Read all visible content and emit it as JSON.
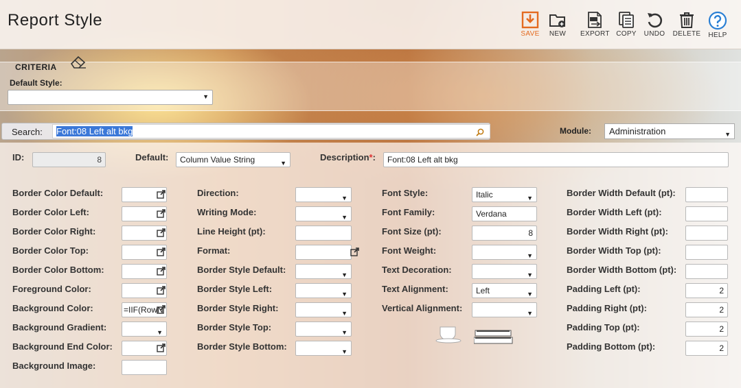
{
  "header": {
    "title": "Report Style",
    "toolbar": [
      {
        "id": "save",
        "label": "SAVE",
        "icon": "save-icon"
      },
      {
        "id": "new",
        "label": "NEW",
        "icon": "new-folder-icon"
      },
      {
        "id": "export",
        "label": "EXPORT",
        "icon": "export-txt-icon"
      },
      {
        "id": "copy",
        "label": "COPY",
        "icon": "copy-icon"
      },
      {
        "id": "undo",
        "label": "UNDO",
        "icon": "undo-icon"
      },
      {
        "id": "delete",
        "label": "DELETE",
        "icon": "trash-icon"
      },
      {
        "id": "help",
        "label": "HELP",
        "icon": "help-icon"
      }
    ]
  },
  "criteria": {
    "title": "CRITERIA",
    "default_style_label": "Default Style:",
    "default_style_value": ""
  },
  "search": {
    "label": "Search:",
    "value": "Font:08 Left alt bkg"
  },
  "module": {
    "label": "Module:",
    "value": "Administration"
  },
  "form": {
    "id_label": "ID:",
    "id_value": "8",
    "default_label": "Default:",
    "default_value": "Column Value String",
    "description_label": "Description",
    "description_value": "Font:08 Left alt bkg",
    "col1": [
      {
        "label": "Border Color Default:",
        "value": ""
      },
      {
        "label": "Border Color Left:",
        "value": ""
      },
      {
        "label": "Border Color Right:",
        "value": ""
      },
      {
        "label": "Border Color Top:",
        "value": ""
      },
      {
        "label": "Border Color Bottom:",
        "value": ""
      },
      {
        "label": "Foreground Color:",
        "value": ""
      },
      {
        "label": "Background Color:",
        "value": "=IIF(RowN"
      },
      {
        "label": "Background Gradient:",
        "value": ""
      },
      {
        "label": "Background End Color:",
        "value": ""
      },
      {
        "label": "Background Image:",
        "value": ""
      }
    ],
    "col2": [
      {
        "label": "Direction:",
        "value": ""
      },
      {
        "label": "Writing Mode:",
        "value": ""
      },
      {
        "label": "Line Height (pt):",
        "value": ""
      },
      {
        "label": "Format:",
        "value": ""
      },
      {
        "label": "Border Style Default:",
        "value": ""
      },
      {
        "label": "Border Style Left:",
        "value": ""
      },
      {
        "label": "Border Style Right:",
        "value": ""
      },
      {
        "label": "Border Style Top:",
        "value": ""
      },
      {
        "label": "Border Style Bottom:",
        "value": ""
      }
    ],
    "col3": [
      {
        "label": "Font Style:",
        "value": "Italic"
      },
      {
        "label": "Font Family:",
        "value": "Verdana"
      },
      {
        "label": "Font Size (pt):",
        "value": "8"
      },
      {
        "label": "Font Weight:",
        "value": ""
      },
      {
        "label": "Text Decoration:",
        "value": ""
      },
      {
        "label": "Text Alignment:",
        "value": "Left"
      },
      {
        "label": "Vertical Alignment:",
        "value": ""
      }
    ],
    "col4": [
      {
        "label": "Border Width Default (pt):",
        "value": ""
      },
      {
        "label": "Border Width Left (pt):",
        "value": ""
      },
      {
        "label": "Border Width Right (pt):",
        "value": ""
      },
      {
        "label": "Border Width Top (pt):",
        "value": ""
      },
      {
        "label": "Border Width Bottom (pt):",
        "value": ""
      },
      {
        "label": "Padding Left (pt):",
        "value": "2"
      },
      {
        "label": "Padding Right (pt):",
        "value": "2"
      },
      {
        "label": "Padding Top (pt):",
        "value": "2"
      },
      {
        "label": "Padding Bottom (pt):",
        "value": "2"
      }
    ]
  },
  "colors": {
    "accent_save": "#e46a1f",
    "help_blue": "#2a7fd4",
    "selection_blue": "#3b78d8"
  }
}
